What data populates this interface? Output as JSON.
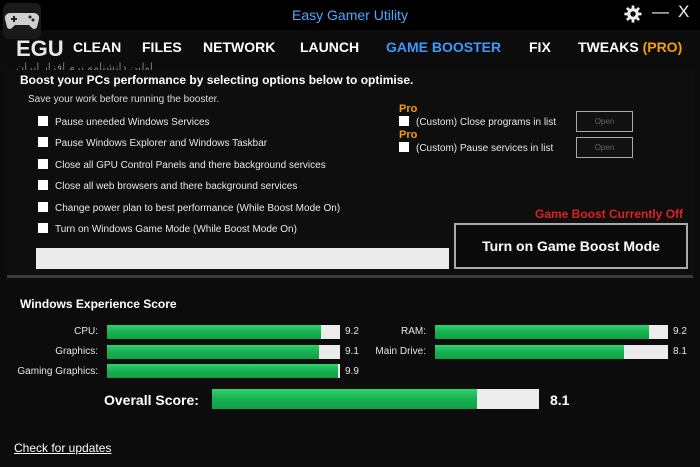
{
  "window": {
    "title": "Easy Gamer Utility",
    "settings_icon": "gear-icon",
    "minimize_label": "—",
    "close_label": "X",
    "logo_text": "EGU",
    "logo_icon": "gamepad-icon"
  },
  "nav": {
    "items": [
      "CLEAN",
      "FILES",
      "NETWORK",
      "LAUNCH",
      "GAME BOOSTER",
      "FIX",
      "TWEAKS"
    ],
    "pro_label": "(PRO)",
    "active": "GAME BOOSTER"
  },
  "watermark": "اولین دانشنامه نرم افزار ایران",
  "booster": {
    "heading": "Boost your PCs performance by selecting options below to optimise.",
    "subheading": "Save your work before running the booster.",
    "options": [
      "Pause uneeded Windows Services",
      "Pause Windows Explorer and Windows Taskbar",
      "Close all GPU Control Panels and there background services",
      "Close all web browsers and there background services",
      "Change power plan to best performance (While Boost Mode On)",
      "Turn on Windows Game Mode (While Boost Mode On)"
    ],
    "pro_tag": "Pro",
    "custom_options": [
      {
        "label": "(Custom) Close programs in list",
        "button": "Open"
      },
      {
        "label": "(Custom) Pause services in list",
        "button": "Open"
      }
    ],
    "status": "Game Boost Currently Off",
    "boost_button": "Turn on Game Boost Mode",
    "progress": 0
  },
  "scores": {
    "heading": "Windows Experience Score",
    "items": [
      {
        "label": "CPU:",
        "value": "9.2",
        "fraction": 0.92
      },
      {
        "label": "Graphics:",
        "value": "9.1",
        "fraction": 0.91
      },
      {
        "label": "Gaming Graphics:",
        "value": "9.9",
        "fraction": 0.99
      },
      {
        "label": "RAM:",
        "value": "9.2",
        "fraction": 0.92
      },
      {
        "label": "Main Drive:",
        "value": "8.1",
        "fraction": 0.81
      }
    ],
    "overall_label": "Overall Score:",
    "overall_value": "8.1",
    "overall_fraction": 0.81
  },
  "footer": {
    "check_updates": "Check for updates"
  },
  "colors": {
    "accent": "#3a9bff",
    "pro": "#f5a000",
    "status_off": "#dd2222",
    "score_bar": "#17b050"
  }
}
